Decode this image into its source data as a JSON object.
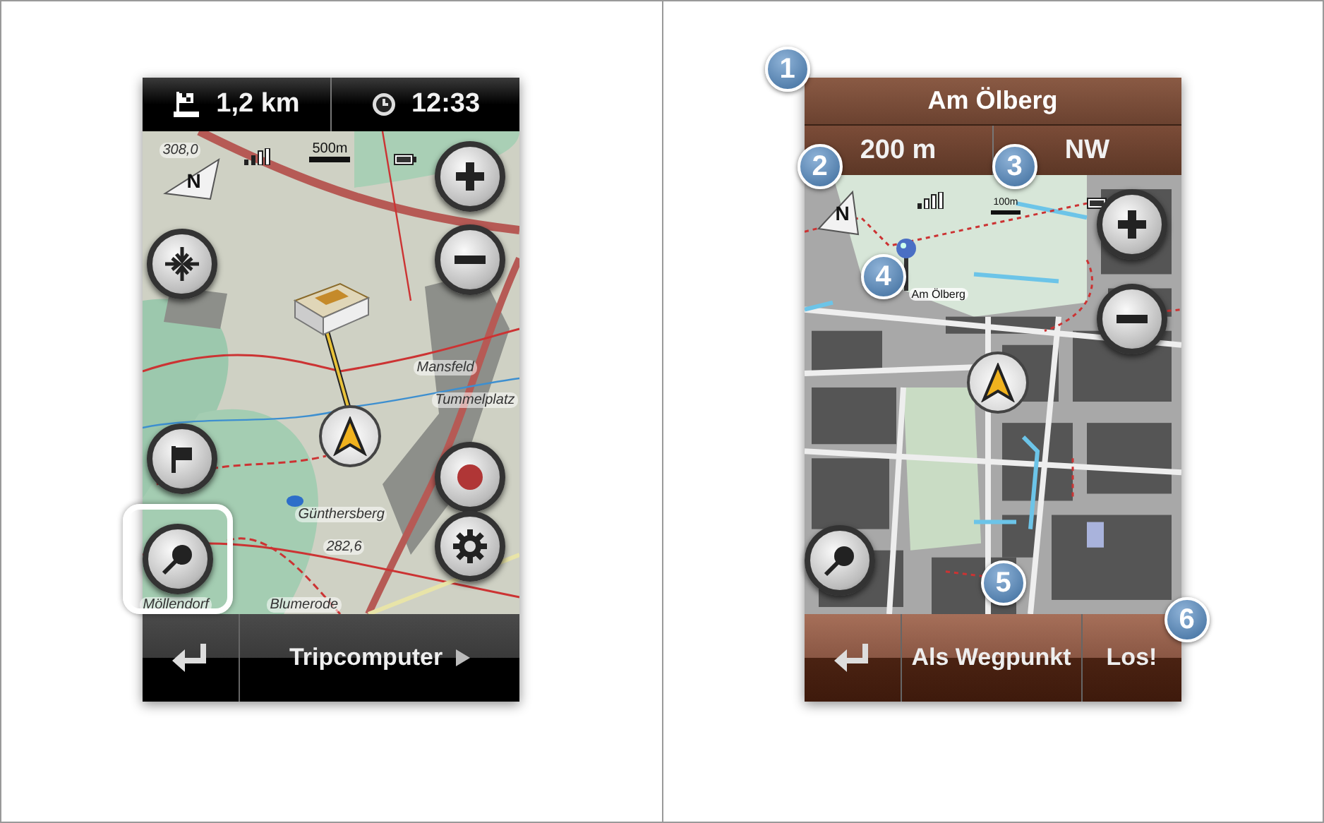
{
  "left_screen": {
    "compass": "N",
    "distance": "1,2 km",
    "time": "12:33",
    "scale": "500m",
    "map_labels": [
      "308,0",
      "Mansfeld",
      "Tummelplatz",
      "Günthersberg",
      "282,6",
      "Möllendorf",
      "Blumerode"
    ],
    "search_button": {
      "highlighted": true
    },
    "bottom_bar": {
      "next": "Tripcomputer"
    }
  },
  "right_screen": {
    "compass": "N",
    "title": "Am Ölberg",
    "distance": "200 m",
    "direction": "NW",
    "scale": "100m",
    "map_labels": [
      "Am Ölberg"
    ],
    "search_button": {
      "highlighted": false
    },
    "bottom_bar": {
      "buttons": [
        "Als Wegpunkt",
        "Los!"
      ]
    },
    "callouts": [
      "1",
      "2",
      "3",
      "4",
      "5",
      "6"
    ]
  }
}
